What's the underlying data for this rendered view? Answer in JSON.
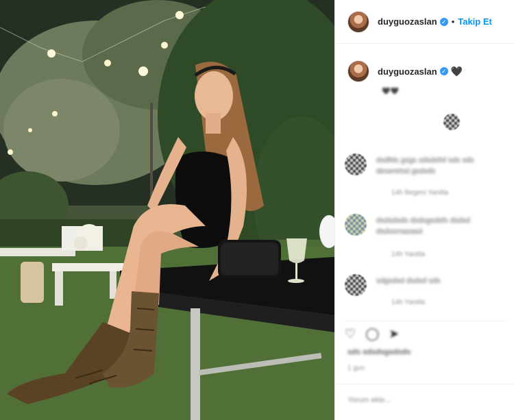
{
  "post": {
    "username": "duyguozaslan",
    "follow_label": "Takip Et",
    "caption_emoji": "🖤",
    "caption_text": "🖤🖤",
    "comments": [
      {
        "author": "user",
        "text": "dsdfds gsgs sdsdsfsf sds sds deseretsd gsdsds",
        "meta": "14h  Begeni  Yanitla"
      },
      {
        "author": "user",
        "text": "dsdsdsds dsdsgsdsfs dsdsd dsdssmasasd",
        "meta": "14h  Yanitla"
      },
      {
        "author": "user",
        "text": "sdgsdsd dsdsd sds",
        "meta": "14h  Yanitla"
      }
    ],
    "likes_text": "sds sdsdsgsdsds",
    "time_text": "1 gun",
    "add_comment_placeholder": "Yorum ekle..."
  },
  "icons": {
    "verified": "verified-badge-icon",
    "heart": "heart-icon",
    "like": "like-icon",
    "comment": "comment-icon",
    "share": "share-icon"
  },
  "colors": {
    "link": "#0095f6",
    "verified": "#3897f0",
    "text": "#262626"
  }
}
